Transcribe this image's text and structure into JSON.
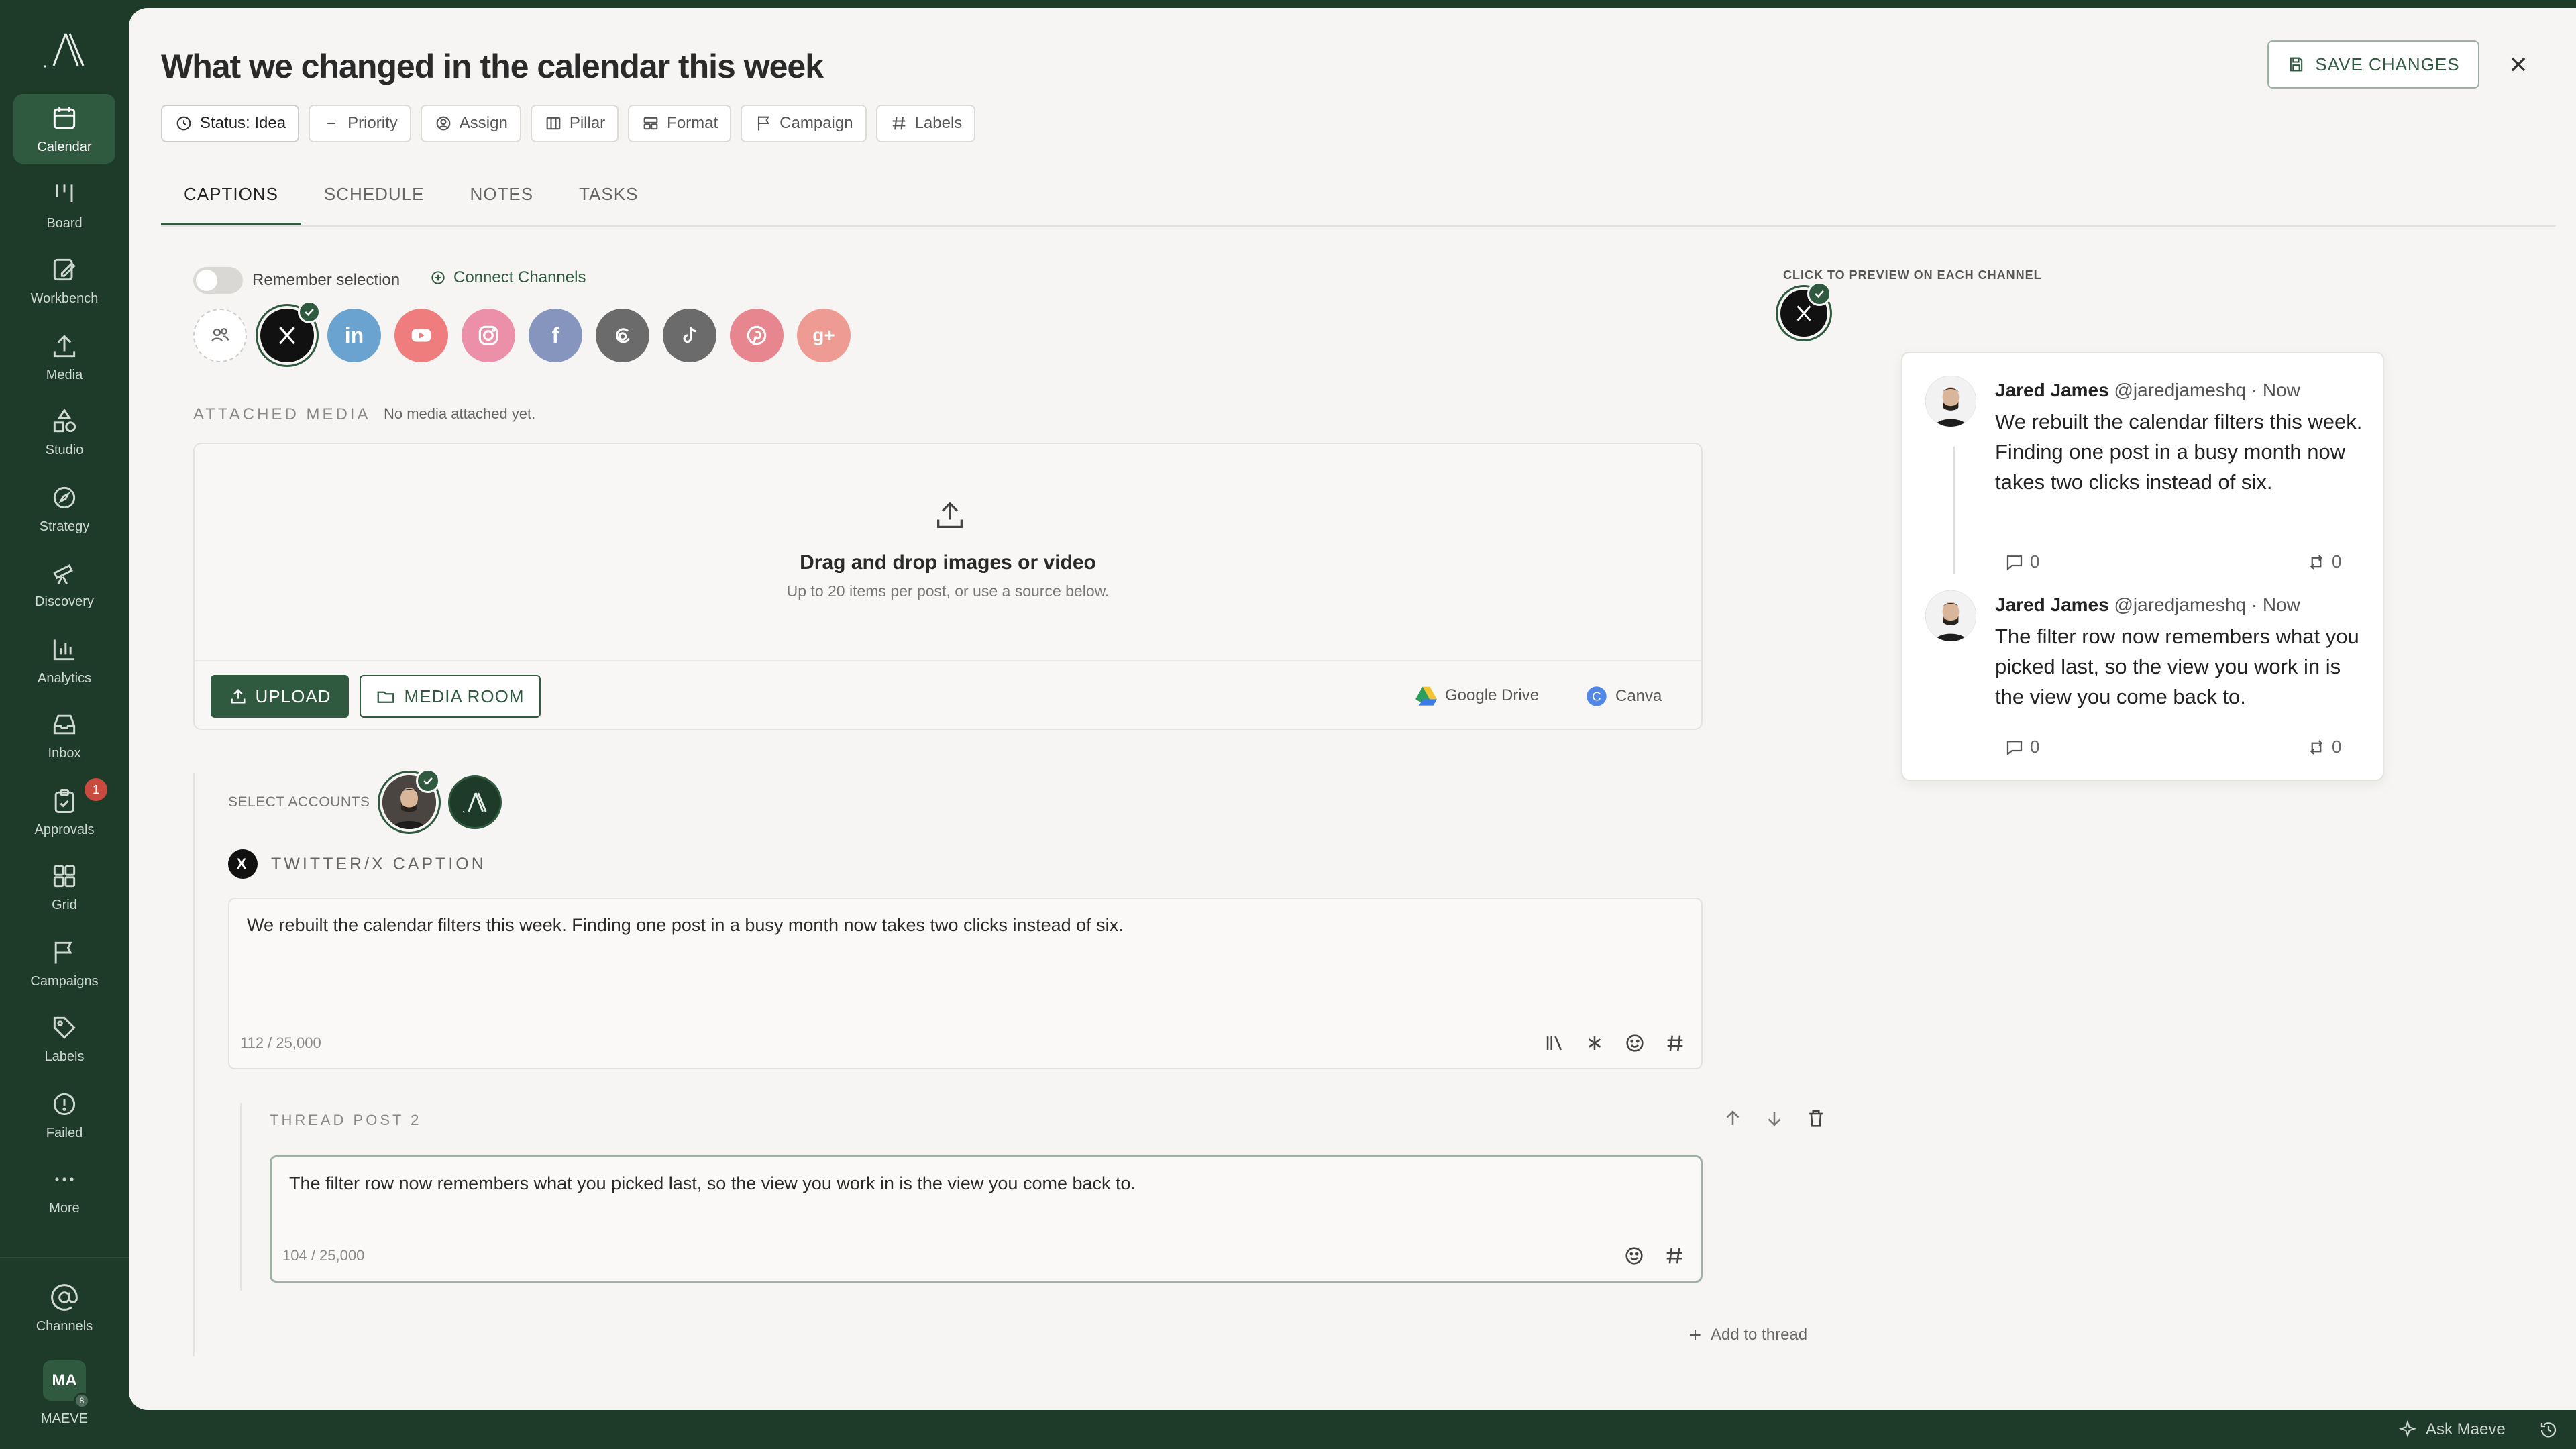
{
  "sidebar": {
    "items": [
      {
        "label": "Calendar",
        "icon": "calendar-icon",
        "active": true
      },
      {
        "label": "Board",
        "icon": "board-icon"
      },
      {
        "label": "Workbench",
        "icon": "workbench-icon"
      },
      {
        "label": "Media",
        "icon": "media-icon"
      },
      {
        "label": "Studio",
        "icon": "studio-icon"
      },
      {
        "label": "Strategy",
        "icon": "strategy-icon"
      },
      {
        "label": "Discovery",
        "icon": "discovery-icon"
      },
      {
        "label": "Analytics",
        "icon": "analytics-icon"
      },
      {
        "label": "Inbox",
        "icon": "inbox-icon"
      },
      {
        "label": "Approvals",
        "icon": "approvals-icon",
        "badge": "1"
      },
      {
        "label": "Grid",
        "icon": "grid-icon"
      },
      {
        "label": "Campaigns",
        "icon": "campaigns-icon"
      },
      {
        "label": "Labels",
        "icon": "labels-icon"
      },
      {
        "label": "Failed",
        "icon": "failed-icon"
      },
      {
        "label": "More",
        "icon": "more-icon"
      }
    ],
    "channels_label": "Channels",
    "user_initials": "MA",
    "user_name": "MAEVE",
    "user_dot": "8"
  },
  "header": {
    "title": "What we changed in the calendar this week",
    "save_label": "SAVE CHANGES"
  },
  "chips": {
    "status": "Status: Idea",
    "priority": "Priority",
    "assign": "Assign",
    "pillar": "Pillar",
    "format": "Format",
    "campaign": "Campaign",
    "labels": "Labels"
  },
  "tabs": [
    "CAPTIONS",
    "SCHEDULE",
    "NOTES",
    "TASKS"
  ],
  "editor": {
    "remember_label": "Remember selection",
    "connect_label": "Connect Channels",
    "channels": [
      "accounts-group",
      "twitter-x",
      "linkedin",
      "youtube",
      "instagram",
      "facebook",
      "threads",
      "tiktok",
      "pinterest",
      "google-business"
    ],
    "channel_colors": {
      "twitter-x": "#111111",
      "linkedin": "#6aa3cf",
      "youtube": "#ef7d7d",
      "instagram": "#ec8fa9",
      "facebook": "#8595bd",
      "threads": "#6b6b6b",
      "tiktok": "#6b6b6b",
      "pinterest": "#e7868f",
      "google-business": "#ee9b93"
    },
    "attached_label": "ATTACHED MEDIA",
    "no_media": "No media attached yet.",
    "drop_title": "Drag and drop images or video",
    "drop_sub": "Up to 20 items per post, or use a source below.",
    "upload_label": "UPLOAD",
    "media_room_label": "MEDIA ROOM",
    "gdrive_label": "Google Drive",
    "canva_label": "Canva",
    "select_accounts": "SELECT ACCOUNTS",
    "caption_label": "TWITTER/X CAPTION",
    "caption_text": "We rebuilt the calendar filters this week. Finding one post in a busy month now takes two clicks instead of six.",
    "caption_count": "112 / 25,000",
    "thread_label": "THREAD POST 2",
    "thread_text": "The filter row now remembers what you picked last, so the view you work in is the view you come back to.",
    "thread_count": "104 / 25,000",
    "add_thread": "Add to thread"
  },
  "preview": {
    "label": "CLICK TO PREVIEW ON EACH CHANNEL",
    "tweets": [
      {
        "name": "Jared James",
        "handle": "@jaredjameshq · Now",
        "text": "We rebuilt the calendar filters this week. Finding one post in a busy month now takes two clicks instead of six.",
        "replies": "0",
        "reposts": "0"
      },
      {
        "name": "Jared James",
        "handle": "@jaredjameshq · Now",
        "text": "The filter row now remembers what you picked last, so the view you work in is the view you come back to.",
        "replies": "0",
        "reposts": "0"
      }
    ]
  },
  "footer": {
    "ask_label": "Ask Maeve"
  },
  "colors": {
    "brand": "#1e3b2a",
    "accent": "#2f5a40",
    "panel": "#f6f5f3"
  }
}
